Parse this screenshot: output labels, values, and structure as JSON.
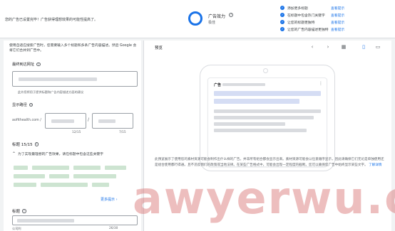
{
  "header": {
    "intro": "您的广告已设置完毕！广告获得理想效果的可能性提高了。",
    "effectiveness_label": "广告效力",
    "effectiveness_value": "极佳",
    "checklist": [
      {
        "text": "添加更多标题",
        "link": "查看提示"
      },
      {
        "text": "在标题中包含热门关键字",
        "link": "查看提示"
      },
      {
        "text": "让您的标题更独特",
        "link": "查看提示"
      },
      {
        "text": "让您的广告内容描述更独特",
        "link": "查看提示"
      }
    ]
  },
  "form": {
    "intro": "使用自适应搜索广告时，您需要输入多个标题和多条广告内容描述。然后 Google 会将它们合并到广告中。",
    "final_url_label": "最终到达网址",
    "final_url_helper": "此外您将用于提供标题和广告内容描述方面的建议",
    "display_path_label": "显示路径",
    "domain": "aofithealth.com /",
    "path_slash": "/",
    "path1_counter": "12/15",
    "path2_counter": "7/15",
    "headlines_label": "标题 15/15",
    "headlines_tip": "为了实现最理想的广告效果，请在标题中包含这些关键字",
    "more_tips": "更多提示",
    "headline_field_label": "标题",
    "headline_counter": "26/30",
    "headline_footer": "公司利"
  },
  "preview": {
    "label": "预览",
    "ad_label": "广告",
    "disclaimer": "此预览展示了使用您的素材资源可能会制作出什么样的广告。并非所有组合都会显示出来。素材资源可能会以任意顺序显示，因此请确保它们无论是单独使用还是组合使用都行得通。且不违反我们的政策或当地法律。在某些广告格式中，可能会出现一定程度的截断。您可以确保您广告中始终显示某些文字。",
    "learn_more": "了解详情"
  },
  "watermark": "awyerwu.com",
  "colors": {
    "accent": "#1a73e8",
    "watermark": "#d66e6e"
  }
}
